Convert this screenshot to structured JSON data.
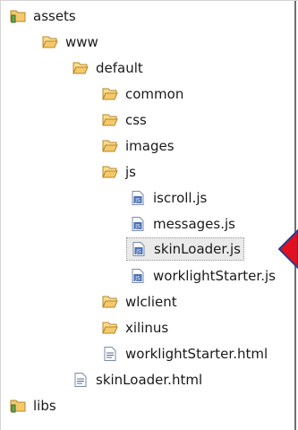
{
  "tree": {
    "items": [
      {
        "label": "assets",
        "icon": "project-folder-icon"
      },
      {
        "label": "www",
        "icon": "folder-open-icon"
      },
      {
        "label": "default",
        "icon": "folder-open-icon"
      },
      {
        "label": "common",
        "icon": "folder-open-icon"
      },
      {
        "label": "css",
        "icon": "folder-open-icon"
      },
      {
        "label": "images",
        "icon": "folder-open-icon"
      },
      {
        "label": "js",
        "icon": "folder-open-icon"
      },
      {
        "label": "iscroll.js",
        "icon": "js-file-icon"
      },
      {
        "label": "messages.js",
        "icon": "js-file-icon"
      },
      {
        "label": "skinLoader.js",
        "icon": "js-file-icon",
        "selected": true
      },
      {
        "label": "worklightStarter.js",
        "icon": "js-file-icon"
      },
      {
        "label": "wlclient",
        "icon": "folder-open-icon"
      },
      {
        "label": "xilinus",
        "icon": "folder-open-icon"
      },
      {
        "label": "worklightStarter.html",
        "icon": "html-file-icon"
      },
      {
        "label": "skinLoader.html",
        "icon": "html-file-icon"
      },
      {
        "label": "libs",
        "icon": "project-folder-icon"
      }
    ]
  },
  "colors": {
    "folder": "#f3c96b",
    "folder_outline": "#b8872a",
    "pointer_fill": "#e01020",
    "pointer_outline": "#2a3d8f",
    "selection": "#eaeaea"
  }
}
